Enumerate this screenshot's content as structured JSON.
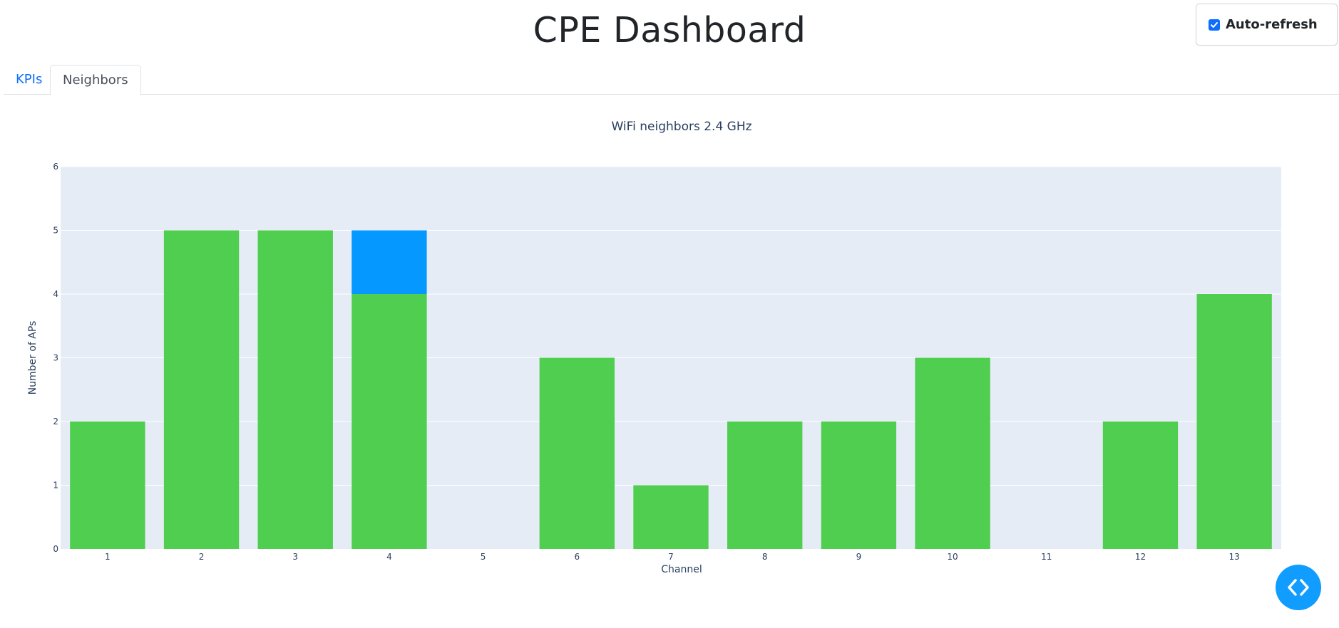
{
  "header": {
    "title": "CPE Dashboard"
  },
  "auto_refresh": {
    "label": "Auto-refresh",
    "checked": true
  },
  "tabs": [
    {
      "label": "KPIs",
      "active": false
    },
    {
      "label": "Neighbors",
      "active": true
    }
  ],
  "colors": {
    "plot_bg": "#e5ecf6",
    "bar_green": "#4fce4f",
    "bar_blue": "#0599ff",
    "axis_text": "#2a3f5f",
    "accent": "#0d6efd"
  },
  "fab": {
    "icon": "code-icon"
  },
  "chart_data": {
    "type": "bar",
    "barmode": "stack",
    "title": "WiFi neighbors 2.4 GHz",
    "xlabel": "Channel",
    "ylabel": "Number of APs",
    "categories": [
      "1",
      "2",
      "3",
      "4",
      "5",
      "6",
      "7",
      "8",
      "9",
      "10",
      "11",
      "12",
      "13"
    ],
    "series": [
      {
        "color": "#4fce4f",
        "values": [
          2,
          5,
          5,
          4,
          0,
          3,
          1,
          2,
          2,
          3,
          0,
          2,
          4
        ]
      },
      {
        "color": "#0599ff",
        "values": [
          0,
          0,
          0,
          1,
          0,
          0,
          0,
          0,
          0,
          0,
          0,
          0,
          0
        ]
      }
    ],
    "ylim": [
      0,
      6
    ],
    "yticks": [
      0,
      1,
      2,
      3,
      4,
      5,
      6
    ],
    "grid": true,
    "legend": "none"
  }
}
